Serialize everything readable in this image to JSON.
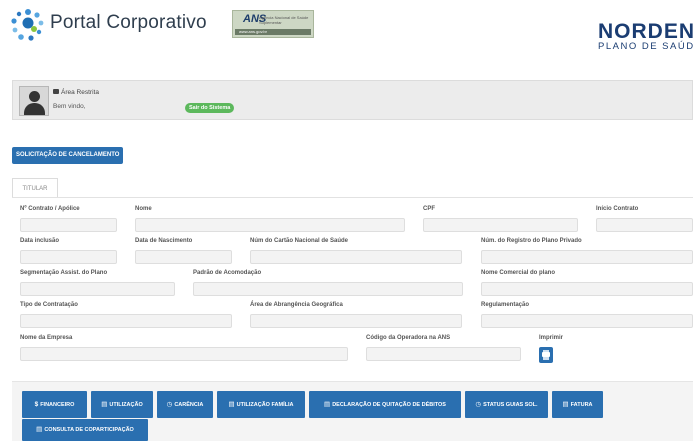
{
  "header": {
    "portal_title": "Portal Corporativo",
    "ans_label": "ANS",
    "ans_subtitle": "Agência Nacional de Saúde Suplementar",
    "ans_bar_text": "www.ans.gov.br",
    "brand": "NORDEN",
    "brand_sub": "PLANO DE SAÚDE",
    "colors": {
      "brand": "#1b3d72",
      "primary": "#2a6fb0",
      "success": "#5cb85c"
    }
  },
  "user": {
    "area_label": "Área Restrita",
    "welcome": "Bem vindo,",
    "logout": "Sair do Sistema"
  },
  "actions": {
    "cancel": "SOLICITAÇÃO DE CANCELAMENTO"
  },
  "tabs": {
    "titular": "TITULAR"
  },
  "form": {
    "contrato": "Nº Contrato / Apólice",
    "nome": "Nome",
    "cpf": "CPF",
    "inicio": "Início Contrato",
    "inclusao": "Data inclusão",
    "nascimento": "Data de Nascimento",
    "cartao": "Núm do Cartão Nacional de Saúde",
    "registro": "Núm. do Registro do Plano Privado",
    "segmentacao": "Segmentação Assist. do Plano",
    "acomodacao": "Padrão de Acomodação",
    "comercial": "Nome Comercial do plano",
    "tipo": "Tipo de Contratação",
    "abrangencia": "Área de Abrangência Geográfica",
    "regulamentacao": "Regulamentação",
    "empresa": "Nome da Empresa",
    "operadora": "Código da Operadora na ANS",
    "imprimir": "Imprimir"
  },
  "nav": {
    "financeiro": "FINANCEIRO",
    "utilizacao": "UTILIZAÇÃO",
    "carencia": "CARÊNCIA",
    "utilizacao_familia": "UTILIZAÇÃO FAMÍLIA",
    "quitacao": "DECLARAÇÃO DE QUITAÇÃO DE DÉBITOS",
    "status": "STATUS GUIAS SOL.",
    "fatura": "FATURA",
    "coparticipacao": "CONSULTA DE COPARTICIPAÇÃO"
  }
}
